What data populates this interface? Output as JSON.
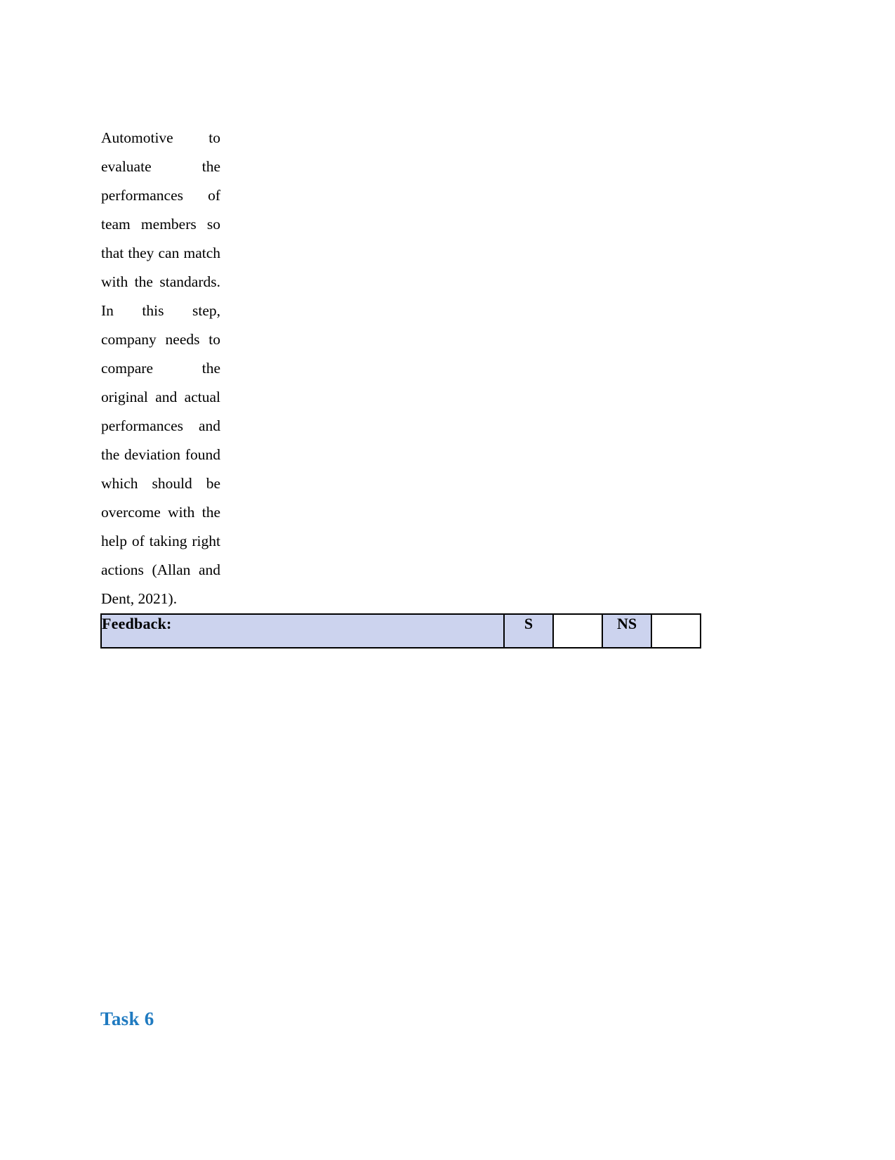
{
  "document": {
    "page_background": "#ffffff",
    "text_color": "#000000"
  },
  "table": {
    "name": "assessment-feedback-table",
    "border_color": "#000000",
    "highlight_color": "#ccd3ee",
    "body_cell": {
      "paragraph": "Automotive to evaluate the performances of team members so that they can match with the standards. In this step, company needs to compare the original and actual performances and the deviation found which should be overcome with the help of taking right actions (Allan and Dent, 2021)."
    },
    "feedback_row": {
      "label": "Feedback:",
      "satisfactory_label": "S",
      "satisfactory_value": "",
      "not_satisfactory_label": "NS",
      "not_satisfactory_value": ""
    },
    "trailing_row": {
      "value": ""
    }
  },
  "heading": {
    "task_title": "Task 6",
    "color": "#1f7ac0"
  }
}
